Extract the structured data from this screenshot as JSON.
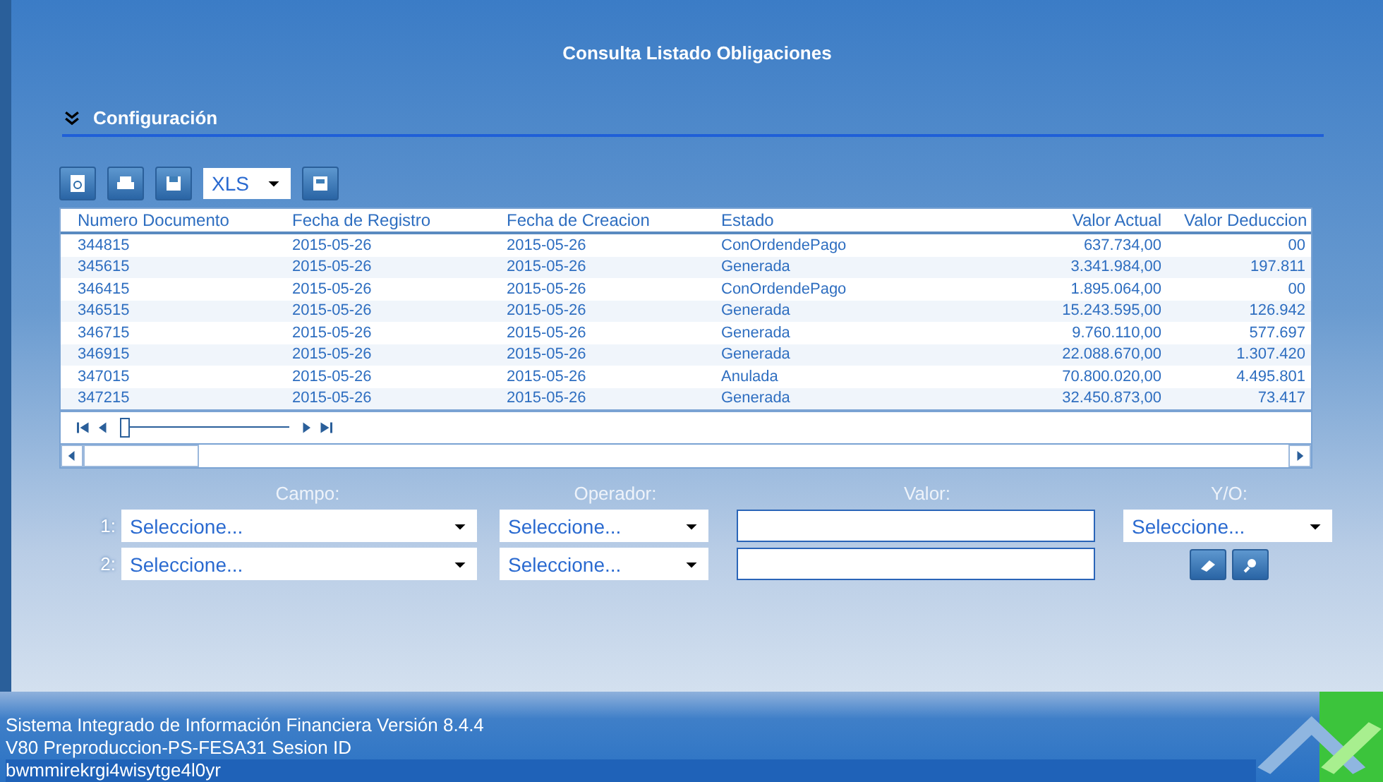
{
  "window": {
    "title": "Consulta Listado Obligaciones"
  },
  "section": {
    "title": "Configuración",
    "expanded": true
  },
  "toolbar": {
    "format": "XLS"
  },
  "table": {
    "columns": [
      "Numero Documento",
      "Fecha de Registro",
      "Fecha de Creacion",
      "Estado",
      "Valor Actual",
      "Valor Deduccion"
    ],
    "rows": [
      [
        "344815",
        "2015-05-26",
        "2015-05-26",
        "ConOrdendePago",
        "637.734,00",
        "00"
      ],
      [
        "345615",
        "2015-05-26",
        "2015-05-26",
        "Generada",
        "3.341.984,00",
        "197.811"
      ],
      [
        "346415",
        "2015-05-26",
        "2015-05-26",
        "ConOrdendePago",
        "1.895.064,00",
        "00"
      ],
      [
        "346515",
        "2015-05-26",
        "2015-05-26",
        "Generada",
        "15.243.595,00",
        "126.942"
      ],
      [
        "346715",
        "2015-05-26",
        "2015-05-26",
        "Generada",
        "9.760.110,00",
        "577.697"
      ],
      [
        "346915",
        "2015-05-26",
        "2015-05-26",
        "Generada",
        "22.088.670,00",
        "1.307.420"
      ],
      [
        "347015",
        "2015-05-26",
        "2015-05-26",
        "Anulada",
        "70.800.020,00",
        "4.495.801"
      ],
      [
        "347215",
        "2015-05-26",
        "2015-05-26",
        "Generada",
        "32.450.873,00",
        "73.417"
      ]
    ],
    "pager": {
      "level": 0.0
    }
  },
  "filters": {
    "headers": [
      "Campo:",
      "Operador:",
      "Valor:",
      "Y/O:"
    ],
    "rows": [
      {
        "number": "1:",
        "campo": "Seleccione...",
        "operador": "Seleccione...",
        "yo": "Seleccione..."
      },
      {
        "number": "2:",
        "campo": "Seleccione...",
        "operador": "Seleccione..."
      }
    ]
  },
  "status_bar": {
    "lines": [
      "Sistema Integrado de Información Financiera Versión 8.4.4",
      "V80 Preproduccion-PS-FESA31 Sesion ID",
      "bwmmirekrgi4wisytge4l0yr"
    ]
  }
}
